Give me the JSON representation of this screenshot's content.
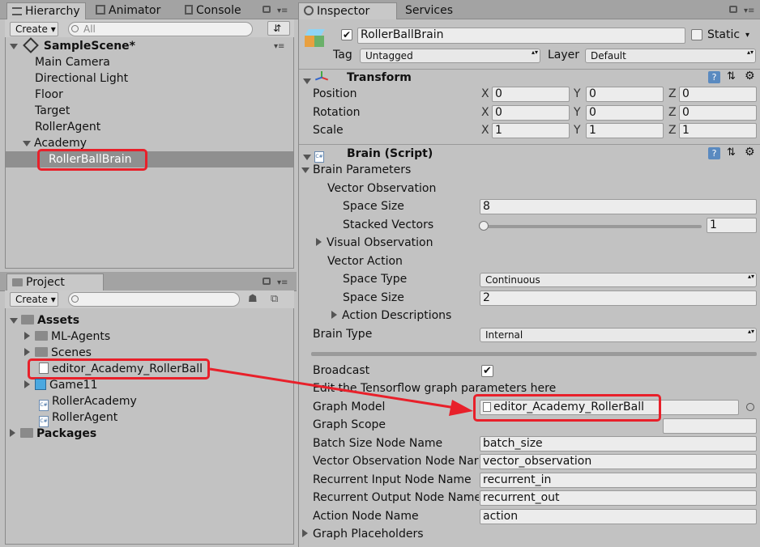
{
  "hierarchy": {
    "tab_label": "Hierarchy",
    "tab2_label": "Animator",
    "tab3_label": "Console",
    "create_label": "Create",
    "search_placeholder": "All",
    "scene_name": "SampleScene*",
    "items": [
      "Main Camera",
      "Directional Light",
      "Floor",
      "Target",
      "RollerAgent",
      "Academy"
    ],
    "selected_child": "RollerBallBrain"
  },
  "project": {
    "tab_label": "Project",
    "create_label": "Create",
    "assets_label": "Assets",
    "items": [
      "ML-Agents",
      "Scenes",
      "editor_Academy_RollerBall",
      "Game11",
      "RollerAcademy",
      "RollerAgent"
    ],
    "packages_label": "Packages"
  },
  "inspector": {
    "tab_label": "Inspector",
    "tab2_label": "Services",
    "object_name": "RollerBallBrain",
    "static_label": "Static",
    "tag_label": "Tag",
    "tag_value": "Untagged",
    "layer_label": "Layer",
    "layer_value": "Default",
    "transform": {
      "title": "Transform",
      "position_label": "Position",
      "rotation_label": "Rotation",
      "scale_label": "Scale",
      "x": "X",
      "y": "Y",
      "z": "Z",
      "position": [
        "0",
        "0",
        "0"
      ],
      "rotation": [
        "0",
        "0",
        "0"
      ],
      "scale": [
        "1",
        "1",
        "1"
      ]
    },
    "brain": {
      "title": "Brain (Script)",
      "brain_parameters": "Brain Parameters",
      "vector_observation": "Vector Observation",
      "space_size_label": "Space Size",
      "space_size_value": "8",
      "stacked_vectors_label": "Stacked Vectors",
      "stacked_vectors_value": "1",
      "stacked_vectors_level": 0.0,
      "visual_observation": "Visual Observation",
      "vector_action": "Vector Action",
      "space_type_label": "Space Type",
      "space_type_value": "Continuous",
      "action_space_size_label": "Space Size",
      "action_space_size_value": "2",
      "action_descriptions": "Action Descriptions",
      "brain_type_label": "Brain Type",
      "brain_type_value": "Internal",
      "broadcast_label": "Broadcast",
      "edit_hint": "Edit the Tensorflow graph parameters here",
      "graph_model_label": "Graph Model",
      "graph_model_value": "editor_Academy_RollerBall",
      "graph_scope_label": "Graph Scope",
      "graph_scope_value": "",
      "batch_size_label": "Batch Size Node Name",
      "batch_size_value": "batch_size",
      "vector_obs_node_label": "Vector Observation Node Nar",
      "vector_obs_node_value": "vector_observation",
      "recurrent_in_label": "Recurrent Input Node Name",
      "recurrent_in_value": "recurrent_in",
      "recurrent_out_label": "Recurrent Output Node Name",
      "recurrent_out_value": "recurrent_out",
      "action_node_label": "Action Node Name",
      "action_node_value": "action",
      "graph_placeholders": "Graph Placeholders"
    }
  },
  "colors": {
    "highlight": "#e8202a",
    "selection": "#8f8f8f"
  }
}
